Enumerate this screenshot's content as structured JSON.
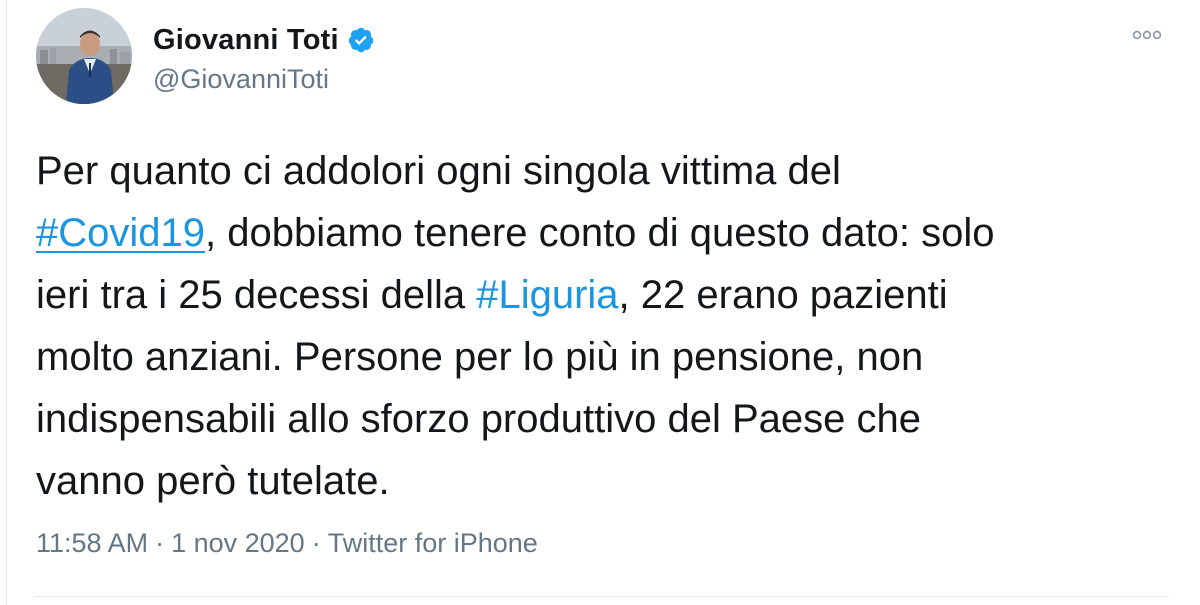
{
  "author": {
    "display_name": "Giovanni Toti",
    "handle": "@GiovanniToti",
    "verified": true
  },
  "icons": {
    "verified": "verified-badge-icon",
    "more": "more-options-icon",
    "avatar": "profile-photo"
  },
  "tweet": {
    "line1": "Per quanto ci addolori ogni singola vittima del",
    "hashtag1": "#Covid19",
    "line2_rest": ", dobbiamo tenere conto di questo dato: solo",
    "line3_start": "ieri tra i 25 decessi della ",
    "hashtag2": "#Liguria",
    "line3_rest": ", 22 erano pazienti",
    "line4": "molto anziani. Persone per lo più in pensione, non",
    "line5": "indispensabili allo sforzo produttivo del Paese che",
    "line6": "vanno però tutelate."
  },
  "meta": {
    "time": "11:58 AM",
    "separator": "·",
    "date": "1 nov 2020",
    "source": "Twitter for iPhone"
  },
  "colors": {
    "link": "#1b95e0",
    "secondary_text": "#657786",
    "text": "#14171a",
    "verified": "#1da1f2"
  }
}
